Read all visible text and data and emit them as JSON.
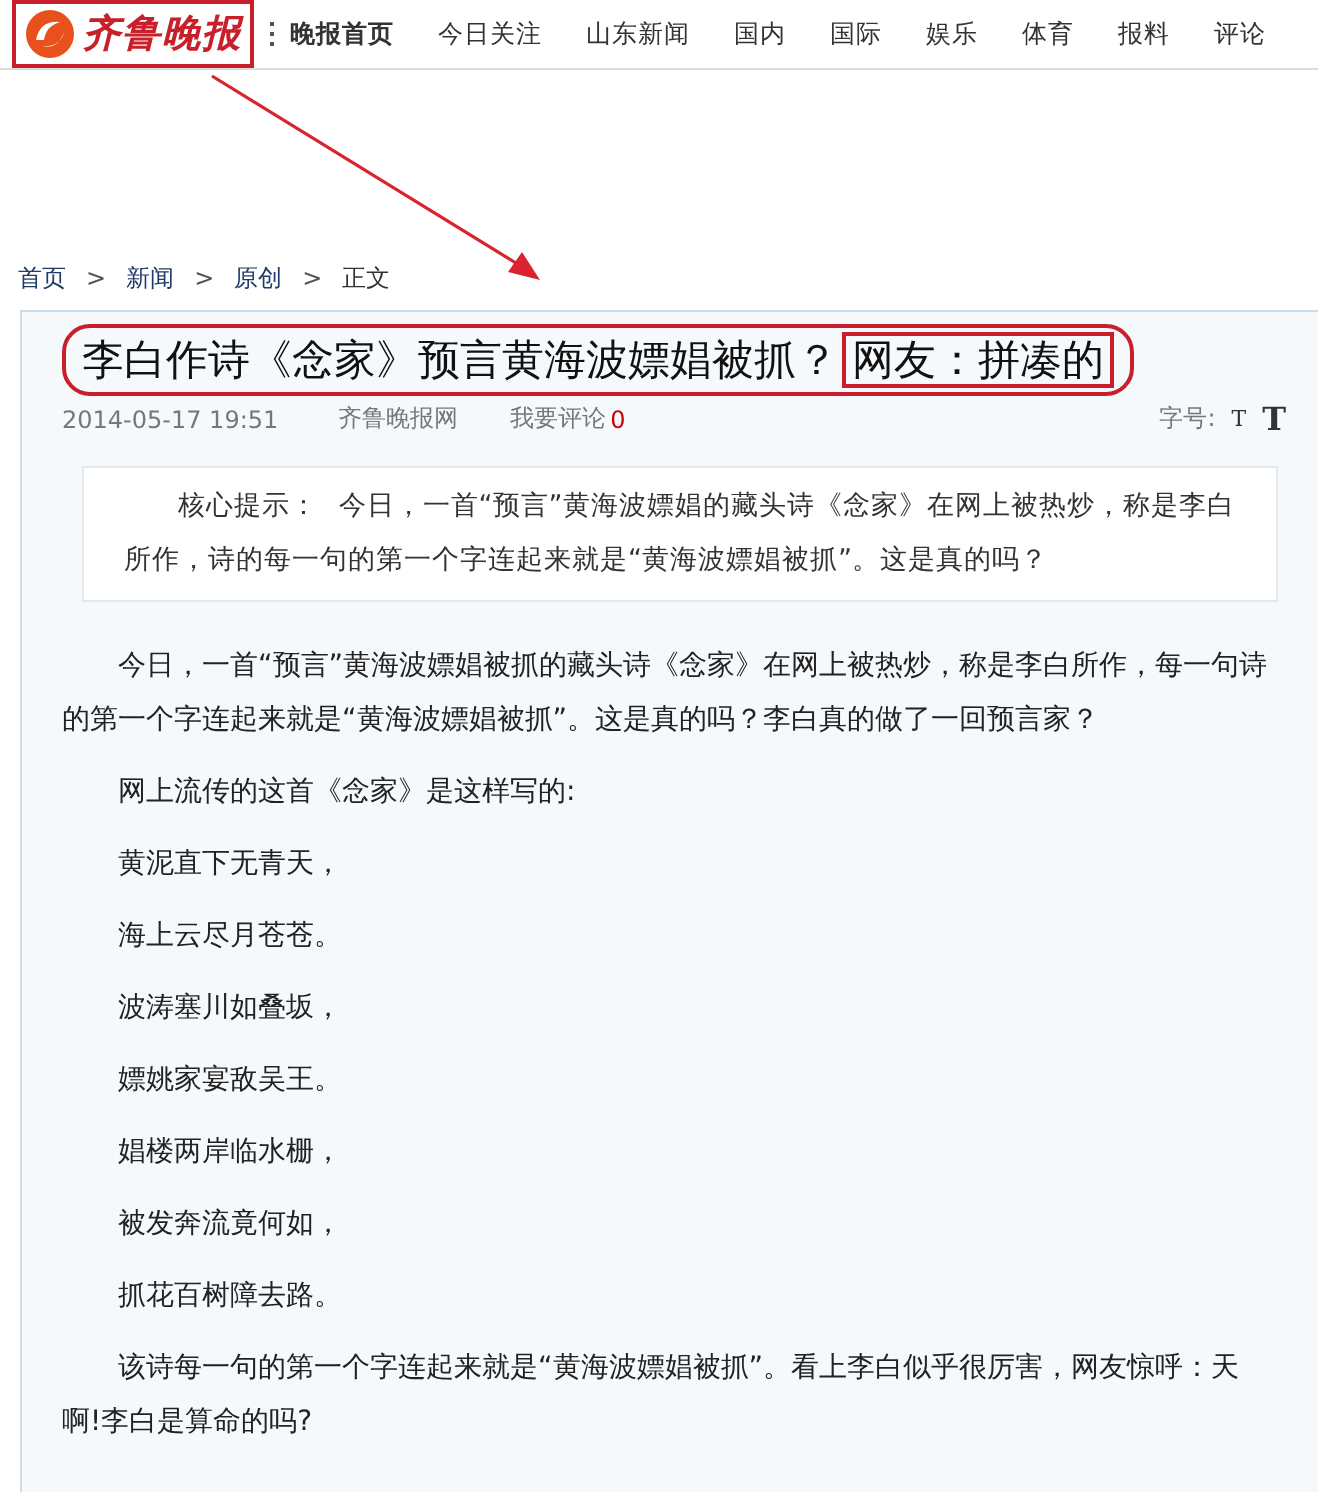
{
  "logo": {
    "text": "齐鲁晚报"
  },
  "nav": [
    {
      "label": "晚报首页",
      "selected": true
    },
    {
      "label": "今日关注",
      "selected": false
    },
    {
      "label": "山东新闻",
      "selected": false
    },
    {
      "label": "国内",
      "selected": false
    },
    {
      "label": "国际",
      "selected": false
    },
    {
      "label": "娱乐",
      "selected": false
    },
    {
      "label": "体育",
      "selected": false
    },
    {
      "label": "报料",
      "selected": false
    },
    {
      "label": "评论",
      "selected": false
    }
  ],
  "breadcrumb": [
    {
      "label": "首页",
      "kind": "link"
    },
    {
      "label": "新闻",
      "kind": "link"
    },
    {
      "label": "原创",
      "kind": "link"
    },
    {
      "label": "正文",
      "kind": "current"
    }
  ],
  "breadcrumb_separator": ">",
  "article": {
    "title": "李白作诗《念家》预言黄海波嫖娼被抓？",
    "title_highlight": "网友：拼凑的",
    "date": "2014-05-17 19:51",
    "source": "齐鲁晚报网",
    "comment_label": "我要评论",
    "comment_count": "0",
    "font_size_label": "字号:",
    "font_small": "T",
    "font_large": "T",
    "summary_label": "核心提示：",
    "summary": "今日，一首“预言”黄海波嫖娼的藏头诗《念家》在网上被热炒，称是李白所作，诗的每一句的第一个字连起来就是“黄海波嫖娼被抓”。这是真的吗？",
    "paragraphs": [
      {
        "text": "今日，一首“预言”黄海波嫖娼被抓的藏头诗《念家》在网上被热炒，称是李白所作，每一句诗的第一个字连起来就是“黄海波嫖娼被抓”。这是真的吗？李白真的做了一回预言家？"
      },
      {
        "text": "网上流传的这首《念家》是这样写的:"
      },
      {
        "text": "黄泥直下无青天，"
      },
      {
        "text": "海上云尽月苍苍。"
      },
      {
        "text": "波涛塞川如叠坂，"
      },
      {
        "text": "嫖姚家宴敌吴王。"
      },
      {
        "text": "娼楼两岸临水栅，"
      },
      {
        "text": "被发奔流竟何如，"
      },
      {
        "text": "抓花百树障去路。"
      },
      {
        "text": "该诗每一句的第一个字连起来就是“黄海波嫖娼被抓”。看上李白似乎很厉害，网友惊呼：天啊!李白是算命的吗?"
      }
    ]
  }
}
